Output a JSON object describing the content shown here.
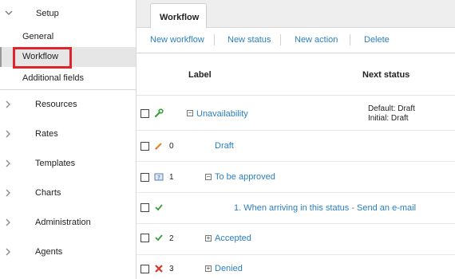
{
  "sidebar": {
    "setup_label": "Setup",
    "sub_items": [
      {
        "label": "General"
      },
      {
        "label": "Workflow"
      },
      {
        "label": "Additional fields"
      }
    ],
    "items": [
      {
        "label": "Resources"
      },
      {
        "label": "Rates"
      },
      {
        "label": "Templates"
      },
      {
        "label": "Charts"
      },
      {
        "label": "Administration"
      },
      {
        "label": "Agents"
      }
    ]
  },
  "tabs": [
    {
      "label": "Workflow"
    }
  ],
  "actions": {
    "new_workflow": "New workflow",
    "new_status": "New status",
    "new_action": "New action",
    "delete": "Delete"
  },
  "table": {
    "headers": {
      "label": "Label",
      "next_status": "Next status"
    },
    "rows": [
      {
        "label": "Unavailability",
        "number": "",
        "icon": "wrench-icon",
        "next_status_lines": [
          "Default: Draft",
          "Initial: Draft"
        ]
      },
      {
        "label": "Draft",
        "number": "0",
        "icon": "pencil-icon"
      },
      {
        "label": "To be approved",
        "number": "1",
        "icon": "pending-icon"
      },
      {
        "label": "1. When arriving in this status - Send an e-mail",
        "number": "",
        "icon": "check-icon"
      },
      {
        "label": "Accepted",
        "number": "2",
        "icon": "check-icon"
      },
      {
        "label": "Denied",
        "number": "3",
        "icon": "cross-icon"
      }
    ]
  },
  "colors": {
    "accent": "#2a7fc0",
    "highlight": "#e0242c",
    "check": "#3aa03a",
    "cross": "#d9362b"
  }
}
